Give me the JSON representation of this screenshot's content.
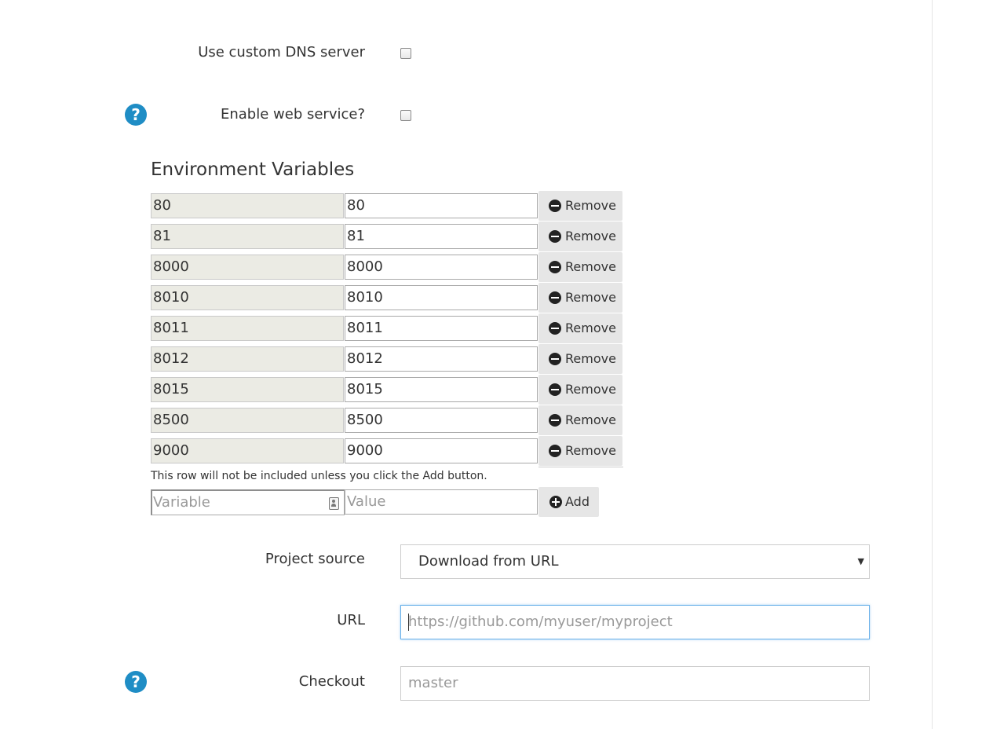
{
  "form": {
    "custom_dns_label": "Use custom DNS server",
    "web_service_label": "Enable web service?",
    "help_glyph": "?",
    "env_section": {
      "title": "Environment Variables",
      "rows": [
        {
          "key": "80",
          "value": "80"
        },
        {
          "key": "81",
          "value": "81"
        },
        {
          "key": "8000",
          "value": "8000"
        },
        {
          "key": "8010",
          "value": "8010"
        },
        {
          "key": "8011",
          "value": "8011"
        },
        {
          "key": "8012",
          "value": "8012"
        },
        {
          "key": "8015",
          "value": "8015"
        },
        {
          "key": "8500",
          "value": "8500"
        },
        {
          "key": "9000",
          "value": "9000"
        }
      ],
      "remove_label": "Remove",
      "hint": "This row will not be included unless you click the Add button.",
      "new_var_placeholder": "Variable",
      "new_val_placeholder": "Value",
      "add_label": "Add"
    },
    "project_source_label": "Project source",
    "project_source_value": "Download from URL",
    "url_label": "URL",
    "url_placeholder": "https://github.com/myuser/myproject",
    "checkout_label": "Checkout",
    "checkout_placeholder": "master"
  },
  "colors": {
    "help_icon": "#1f8dc5",
    "readonly_field": "#ebebe4",
    "button_bg": "#e6e6e6",
    "focus_border": "#66afe9"
  },
  "icons": {
    "help": "question-circle-icon",
    "remove": "minus-circle-icon",
    "add": "plus-circle-icon",
    "autofill": "contact-card-icon",
    "dropdown": "caret-down-icon"
  }
}
